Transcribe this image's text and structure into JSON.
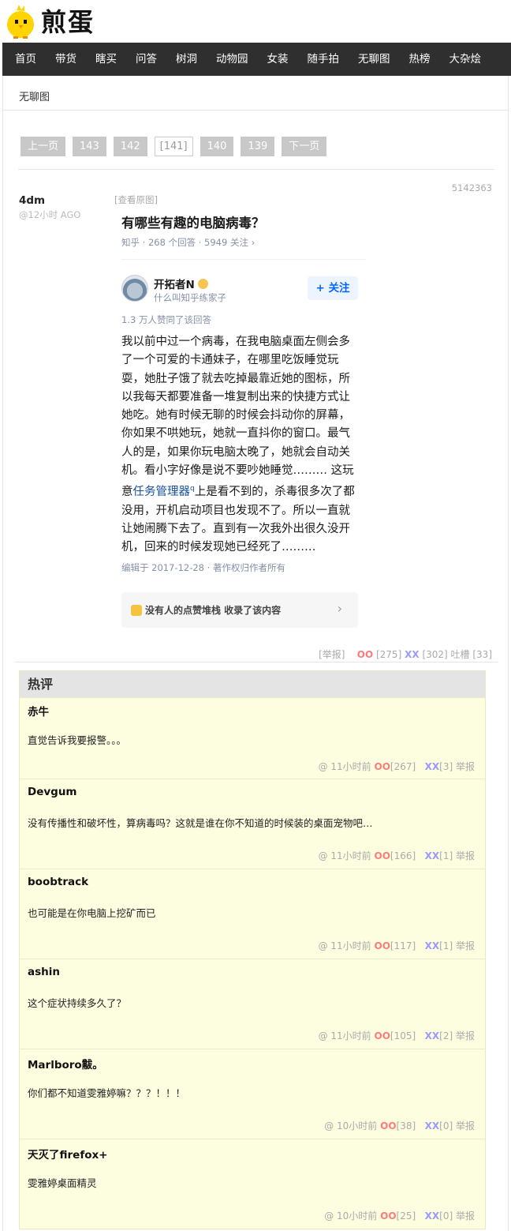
{
  "site": {
    "logo_text": "煎蛋",
    "logo_icon": "chick-icon"
  },
  "nav": {
    "items": [
      "首页",
      "带货",
      "瞎买",
      "问答",
      "树洞",
      "动物园",
      "女装",
      "随手拍",
      "无聊图",
      "热榜",
      "大杂烩"
    ]
  },
  "breadcrumb": "无聊图",
  "pager": {
    "prev": "上一页",
    "pages": [
      "143",
      "142",
      "[141]",
      "140",
      "139"
    ],
    "next": "下一页"
  },
  "post": {
    "author": "4dm",
    "ago": "@12小时 AGO",
    "id": "5142363",
    "view_original": "[查看原图]",
    "image": {
      "title": "有哪些有趣的电脑病毒？",
      "meta": "知乎 · 268 个回答 · 5949 关注 ›",
      "answerer": "开拓者N",
      "bio": "什么叫知乎练家子",
      "follow": "+ 关注",
      "votes": "1.3 万人赞同了该回答",
      "body_part1": "我以前中过一个病毒，在我电脑桌面左侧会多了一个可爱的卡通妹子，在哪里吃饭睡觉玩耍，她肚子饿了就去吃掉最靠近她的图标，所以我每天都要准备一堆复制出来的快捷方式让她吃。她有时候无聊的时候会抖动你的屏幕，你如果不哄她玩，她就一直抖你的窗口。最气人的是，如果你玩电脑太晚了，她就会自动关机。看小字好像是说不要吵她睡觉……… 这玩意",
      "body_link": "任务管理器",
      "body_part2": "上是看不到的，杀毒很多次了都没用，开机启动项目也发现不了。所以一直就让她闹腾下去了。直到有一次我外出很久没开机，回来的时候发现她已经死了………",
      "edited": "编辑于 2017-12-28 · 著作权归作者所有",
      "collect": "没有人的点赞堆栈 收录了该内容",
      "collect_chevron": "›"
    },
    "actions": {
      "report": "[举报]",
      "oo_label": "OO",
      "oo_count": "[275]",
      "xx_label": "XX",
      "xx_count": "[302]",
      "tucao": "吐槽 [33]"
    }
  },
  "hot_comments": {
    "heading": "热评",
    "items": [
      {
        "author": "赤牛",
        "text": "直觉告诉我要报警。。。",
        "time": "@  11小时前",
        "oo": "OO",
        "oo_count": "[267]",
        "xx": "XX",
        "xx_count": "[3]",
        "report": "举报"
      },
      {
        "author": "Devgum",
        "text": "没有传播性和破坏性，算病毒吗？这就是谁在你不知道的时候装的桌面宠物吧…",
        "time": "@  11小时前",
        "oo": "OO",
        "oo_count": "[166]",
        "xx": "XX",
        "xx_count": "[1]",
        "report": "举报"
      },
      {
        "author": "boobtrack",
        "text": "也可能是在你电脑上挖矿而已",
        "time": "@  11小时前",
        "oo": "OO",
        "oo_count": "[117]",
        "xx": "XX",
        "xx_count": "[1]",
        "report": "举报"
      },
      {
        "author": "ashin",
        "text": "这个症状持续多久了？",
        "time": "@  11小时前",
        "oo": "OO",
        "oo_count": "[105]",
        "xx": "XX",
        "xx_count": "[2]",
        "report": "举报"
      },
      {
        "author": "Marlboro黻。",
        "text": "你们都不知道雯雅婷嘛？？？！！！",
        "time": "@  10小时前",
        "oo": "OO",
        "oo_count": "[38]",
        "xx": "XX",
        "xx_count": "[0]",
        "report": "举报"
      },
      {
        "author": "天灭了firefox+",
        "text": "雯雅婷桌面精灵",
        "time": "@  10小时前",
        "oo": "OO",
        "oo_count": "[25]",
        "xx": "XX",
        "xx_count": "[0]",
        "report": "举报"
      }
    ]
  },
  "colors": {
    "nav_bg": "#2f2f2f",
    "hot_bg": "#fdfee0",
    "oo": "#ff7b7b",
    "xx": "#9a9aff",
    "zhihu_blue": "#0066ff"
  }
}
